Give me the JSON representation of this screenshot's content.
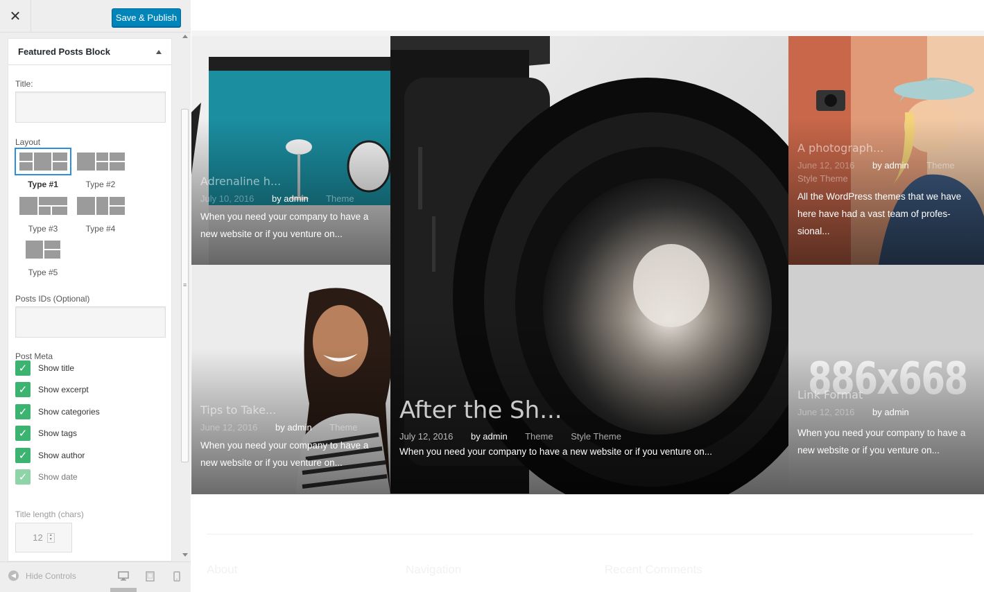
{
  "header": {
    "close_glyph": "✕",
    "publish_label": "Save & Publish"
  },
  "section": {
    "title": "Featured Posts Block"
  },
  "fields": {
    "title_label": "Title:",
    "title_value": "",
    "layout_label": "Layout",
    "post_ids_label": "Posts IDs (Optional)",
    "post_ids_value": "",
    "post_meta_label": "Post Meta",
    "title_length_label": "Title length (chars)",
    "title_length_value": "12"
  },
  "layouts": [
    {
      "name": "Type #1",
      "selected": true
    },
    {
      "name": "Type #2",
      "selected": false
    },
    {
      "name": "Type #3",
      "selected": false
    },
    {
      "name": "Type #4",
      "selected": false
    },
    {
      "name": "Type #5",
      "selected": false
    }
  ],
  "post_meta": [
    {
      "label": "Show title",
      "checked": true
    },
    {
      "label": "Show excerpt",
      "checked": true
    },
    {
      "label": "Show categories",
      "checked": true
    },
    {
      "label": "Show tags",
      "checked": true
    },
    {
      "label": "Show author",
      "checked": true
    },
    {
      "label": "Show date",
      "checked": true
    }
  ],
  "sidebar_footer": {
    "hide_label": "Hide Controls",
    "icons": [
      "desktop-icon",
      "tablet-icon",
      "mobile-icon"
    ]
  },
  "posts": [
    {
      "title": "Adrenaline h...",
      "date": "July 10, 2016",
      "author": "by admin",
      "categories": [
        "Theme"
      ],
      "excerpt": "When you need your company to have a new website or if you venture on..."
    },
    {
      "title": "After the Sh...",
      "date": "July 12, 2016",
      "author": "by admin",
      "categories": [
        "Theme",
        "Style Theme"
      ],
      "excerpt": "When you need your company to have a new website or if you venture on..."
    },
    {
      "title": "A photograph...",
      "date": "June 12, 2016",
      "author": "by admin",
      "categories": [
        "Theme",
        "Style Theme"
      ],
      "excerpt": "All the WordPress themes that we have here have had a vast team of profes-sional..."
    },
    {
      "title": "Tips to Take...",
      "date": "June 12, 2016",
      "author": "by admin",
      "categories": [
        "Theme"
      ],
      "excerpt": "When you need your company to have a new website or if you venture on..."
    },
    {
      "title": "Link Format",
      "date": "June 12, 2016",
      "author": "by admin",
      "categories": [],
      "placeholder_text": "886x668",
      "excerpt": "When you need your company to have a new website or if you venture on..."
    }
  ],
  "footer_widgets": [
    "About",
    "Navigation",
    "Recent Comments"
  ],
  "colors": {
    "accent": "#0085ba",
    "check_green": "#3cb371",
    "selected_border": "#2a8fe0"
  }
}
